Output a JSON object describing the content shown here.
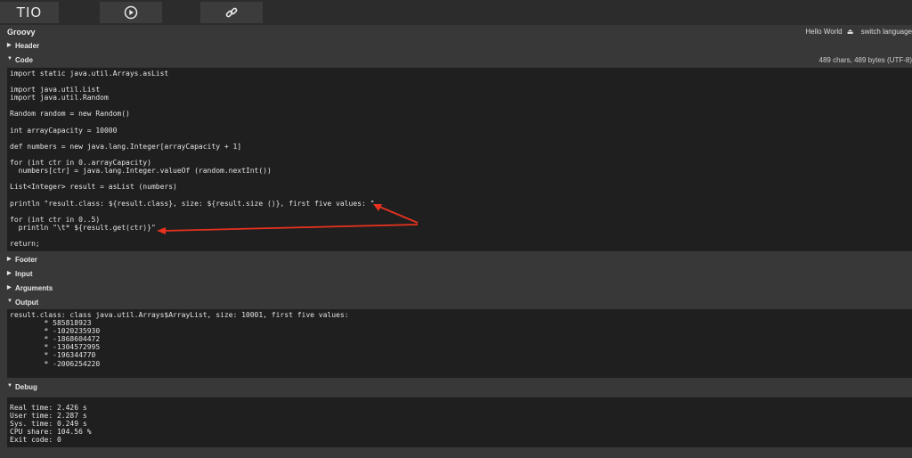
{
  "toolbar": {
    "logo_text": "TIO",
    "icons": [
      "run-icon",
      "link-icon"
    ]
  },
  "language": {
    "name": "Groovy",
    "hello_world": "Hello World",
    "switch_language": "switch language"
  },
  "sections": {
    "header": "Header",
    "code": "Code",
    "code_meta": "489 chars, 489 bytes (UTF-8)",
    "footer": "Footer",
    "input": "Input",
    "arguments": "Arguments",
    "output": "Output",
    "debug": "Debug"
  },
  "code_text": "import static java.util.Arrays.asList\n\nimport java.util.List\nimport java.util.Random\n\nRandom random = new Random()\n\nint arrayCapacity = 10000\n\ndef numbers = new java.lang.Integer[arrayCapacity + 1]\n\nfor (int ctr in 0..arrayCapacity)\n  numbers[ctr] = java.lang.Integer.valueOf (random.nextInt())\n\nList<Integer> result = asList (numbers)\n\nprintln \"result.class: ${result.class}, size: ${result.size ()}, first five values: \"\n\nfor (int ctr in 0..5)\n  println \"\\t* ${result.get(ctr)}\"\n\nreturn;",
  "output_text": "result.class: class java.util.Arrays$ArrayList, size: 10001, first five values:\n        * 585818923\n        * -1020235930\n        * -1868604472\n        * -1304572995\n        * -196344770\n        * -2006254220",
  "debug_text": "Real time: 2.426 s\nUser time: 2.287 s\nSys. time: 0.249 s\nCPU share: 104.56 %\nExit code: 0",
  "annotation_color": "#e8321f"
}
